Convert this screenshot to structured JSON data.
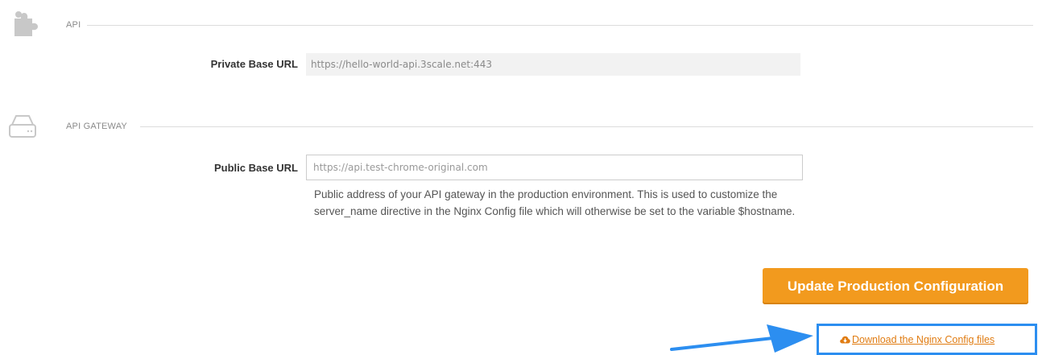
{
  "api_section": {
    "icon": "puzzle-piece-icon",
    "label": "API",
    "private_base_url": {
      "label": "Private Base URL",
      "value": "https://hello-world-api.3scale.net:443"
    }
  },
  "gateway_section": {
    "icon": "server-drive-icon",
    "label": "API GATEWAY",
    "public_base_url": {
      "label": "Public Base URL",
      "placeholder": "https://api.test-chrome-original.com",
      "help": "Public address of your API gateway in the production environment. This is used to customize the server_name directive in the Nginx Config file which will otherwise be set to the variable $hostname."
    }
  },
  "actions": {
    "update_label": "Update Production Configuration",
    "download_label": "Download the Nginx Config files",
    "download_icon": "cloud-download-icon"
  },
  "colors": {
    "accent_orange": "#f29a1e",
    "link_orange": "#e07c12",
    "highlight_blue": "#2c8ef0"
  }
}
